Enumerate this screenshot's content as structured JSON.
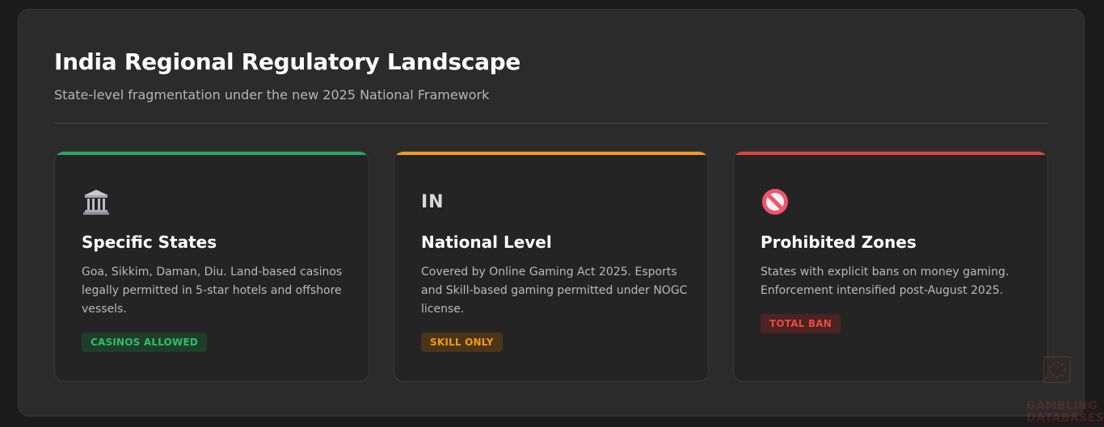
{
  "header": {
    "title": "India Regional Regulatory Landscape",
    "subtitle": "State-level fragmentation under the new 2025 National Framework"
  },
  "cards": [
    {
      "icon": "bank-building-icon",
      "accent": "#27a95e",
      "title": "Specific States",
      "description": "Goa, Sikkim, Daman, Diu. Land-based casinos legally permitted in 5-star hotels and offshore vessels.",
      "badge": "CASINOS ALLOWED"
    },
    {
      "icon": "india-flag-icon",
      "icon_text": "IN",
      "accent": "#f59a1a",
      "title": "National Level",
      "description": "Covered by Online Gaming Act 2025. Esports and Skill-based gaming permitted under NOGC license.",
      "badge": "SKILL ONLY"
    },
    {
      "icon": "prohibited-icon",
      "accent": "#e5443b",
      "title": "Prohibited Zones",
      "description": "States with explicit bans on money gaming. Enforcement intensified post-August 2025.",
      "badge": "TOTAL BAN"
    }
  ],
  "watermark": {
    "line1": "GAMBLING",
    "line2": "DATABASES"
  }
}
